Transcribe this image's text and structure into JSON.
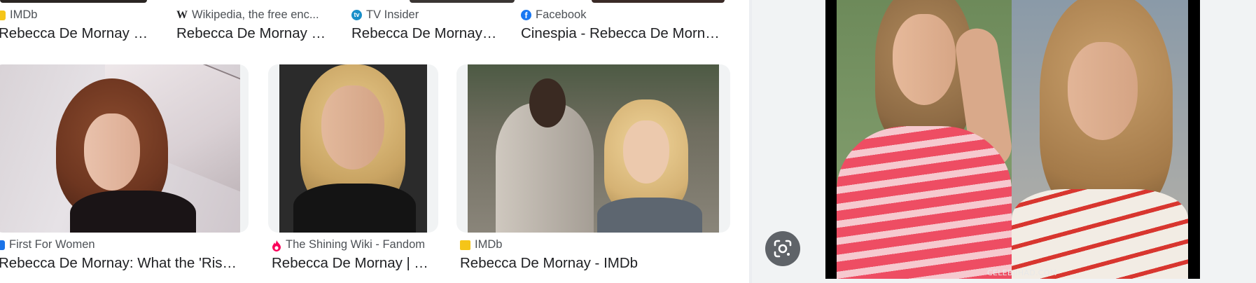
{
  "top_row": [
    {
      "source": "IMDb",
      "favicon": "imdb-icon",
      "title": "Rebecca De Mornay - I..."
    },
    {
      "source": "Wikipedia, the free enc...",
      "favicon": "wikipedia-icon",
      "title": "Rebecca De Mornay - ..."
    },
    {
      "source": "TV Insider",
      "favicon": "tv-insider-icon",
      "title": "Rebecca De Mornay -..."
    },
    {
      "source": "Facebook",
      "favicon": "facebook-icon",
      "title": "Cinespia - Rebecca De Mornay ..."
    }
  ],
  "bottom_row": [
    {
      "source": "First For Women",
      "favicon": "first-for-women-icon",
      "title": "Rebecca De Mornay: What the 'Risky B..."
    },
    {
      "source": "The Shining Wiki - Fandom",
      "favicon": "fandom-icon",
      "title": "Rebecca De Mornay | Th..."
    },
    {
      "source": "IMDb",
      "favicon": "imdb-icon",
      "title": "Rebecca De Mornay - IMDb"
    }
  ],
  "preview": {
    "watermark": "CELEBJIHAD.COM",
    "lens_icon": "google-lens-icon"
  },
  "colors": {
    "imdb": "#f5c518",
    "facebook": "#1877f2",
    "tv_insider": "#1a8fc9",
    "fandom": "#fa005a",
    "first_for_women": "#1a73e8",
    "panel_bg": "#f1f3f4",
    "lens_button": "#5f6368"
  }
}
